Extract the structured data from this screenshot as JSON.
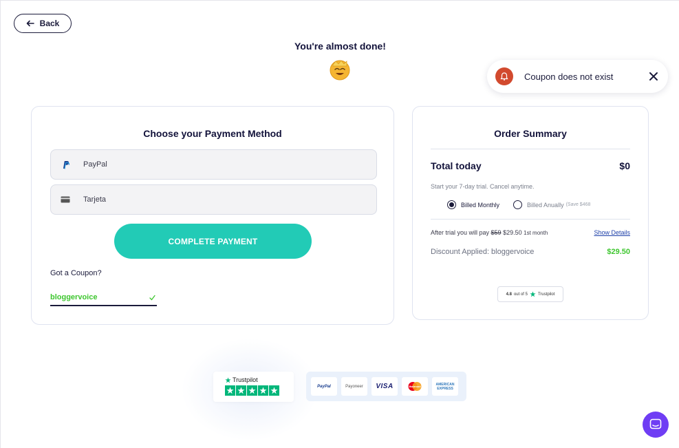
{
  "nav": {
    "back_label": "Back"
  },
  "header": {
    "title": "You're almost done!"
  },
  "toast": {
    "message": "Coupon does not exist"
  },
  "payment": {
    "title": "Choose your Payment Method",
    "methods": [
      {
        "label": "PayPal",
        "icon": "paypal-icon"
      },
      {
        "label": "Tarjeta",
        "icon": "credit-card-icon"
      }
    ],
    "complete_label": "COMPLETE PAYMENT",
    "coupon_label": "Got a Coupon?",
    "coupon_value": "bloggervoice"
  },
  "order": {
    "title": "Order Summary",
    "total_label": "Total today",
    "total_value": "$0",
    "trial_note": "Start your 7-day trial. Cancel anytime.",
    "billing_monthly": "Billed Monthly",
    "billing_annually": "Billed Anually",
    "save_note": "(Save $468",
    "billing_selected": "monthly",
    "after_trial_prefix": "After trial you will pay",
    "old_price": "$59",
    "new_price": "$29.50",
    "first_month": "1st month",
    "show_details": "Show Details",
    "discount_label": "Discount Applied: bloggervoice",
    "discount_value": "$29.50",
    "trustpilot_badge": {
      "rating": "4.8",
      "out_of": "out of 5",
      "brand": "Trustpilot"
    }
  },
  "footer": {
    "trustpilot_name": "Trustpilot",
    "payment_logos": [
      "PayPal",
      "Payoneer",
      "VISA",
      "Mastercard",
      "AMERICAN EXPRESS"
    ]
  },
  "colors": {
    "accent": "#22cbb6",
    "success": "#3ec62f",
    "error": "#d24a2e",
    "chat": "#6f3df4",
    "text": "#12123a"
  }
}
